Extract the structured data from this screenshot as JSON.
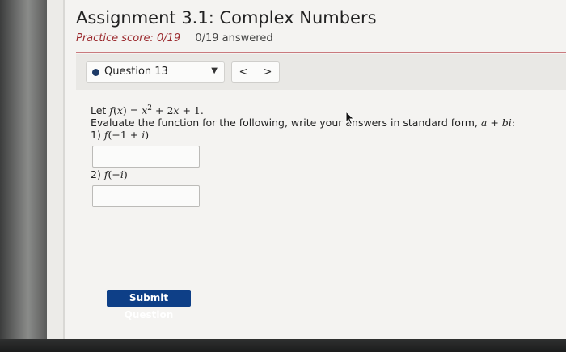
{
  "assignment": {
    "title": "Assignment 3.1: Complex Numbers",
    "practice_score": "Practice score: 0/19",
    "answered": "0/19 answered"
  },
  "question_nav": {
    "selected": "Question 13",
    "prev_symbol": "<",
    "next_symbol": ">",
    "status_color": "#1e3a66"
  },
  "problem": {
    "let_prefix": "Let",
    "instruction": "Evaluate the function for the following, write your answers in standard form,",
    "part1_label": "1)",
    "part2_label": "2)"
  },
  "submit": {
    "label": "Submit Question",
    "color": "#0e3f87"
  }
}
